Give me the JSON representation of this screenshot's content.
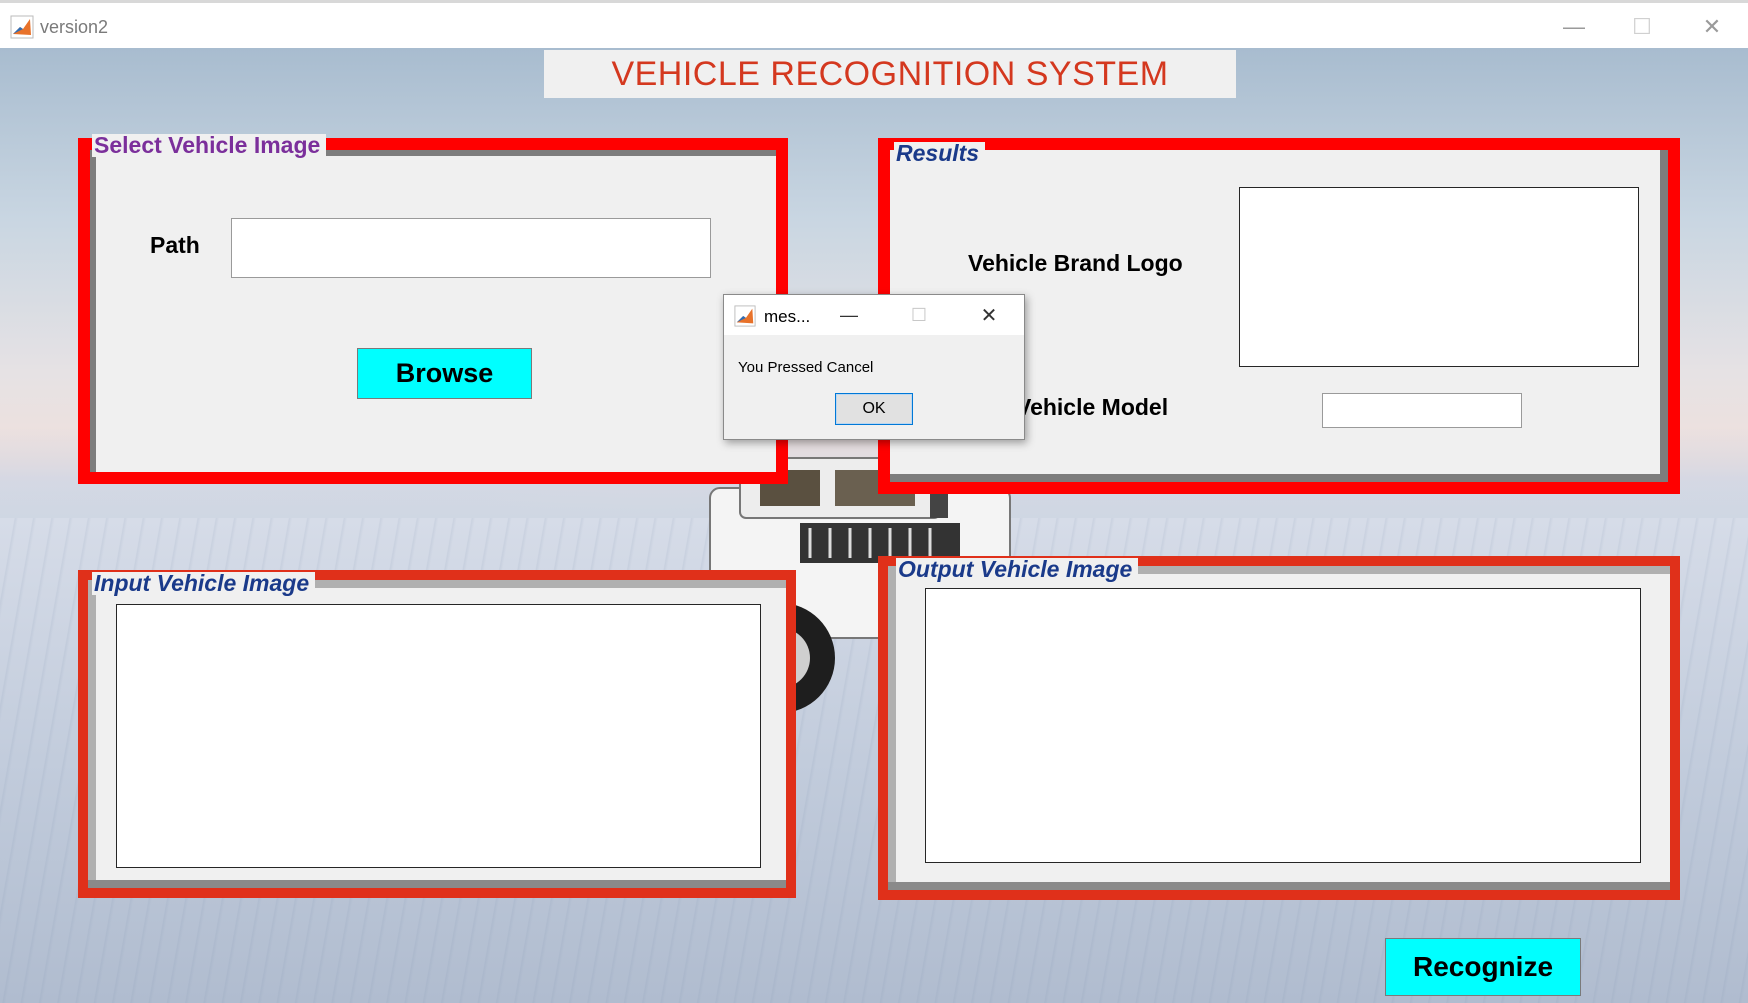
{
  "window": {
    "title": "version2",
    "minimize_glyph": "—",
    "maximize_glyph": "☐",
    "close_glyph": "✕"
  },
  "banner": {
    "text": "VEHICLE RECOGNITION SYSTEM"
  },
  "select_panel": {
    "legend": "Select Vehicle Image",
    "path_label": "Path",
    "path_value": "",
    "browse_label": "Browse"
  },
  "results_panel": {
    "legend": "Results",
    "brand_logo_label": "Vehicle Brand Logo",
    "model_label": "Vehicle Model",
    "model_value": ""
  },
  "input_panel": {
    "legend": "Input Vehicle Image"
  },
  "output_panel": {
    "legend": "Output Vehicle Image"
  },
  "recognize_label": "Recognize",
  "dialog": {
    "title": "mes...",
    "message": "You Pressed Cancel",
    "ok_label": "OK",
    "minimize_glyph": "—",
    "maximize_glyph": "☐",
    "close_glyph": "✕"
  },
  "colors": {
    "banner_text": "#d4381f",
    "panel_border": "#ff0000",
    "legend_purple": "#7b2f9b",
    "legend_blue": "#1a3a8a",
    "button_cyan": "#00ffff"
  },
  "icons": {
    "app": "matlab-icon",
    "dialog": "matlab-icon"
  }
}
